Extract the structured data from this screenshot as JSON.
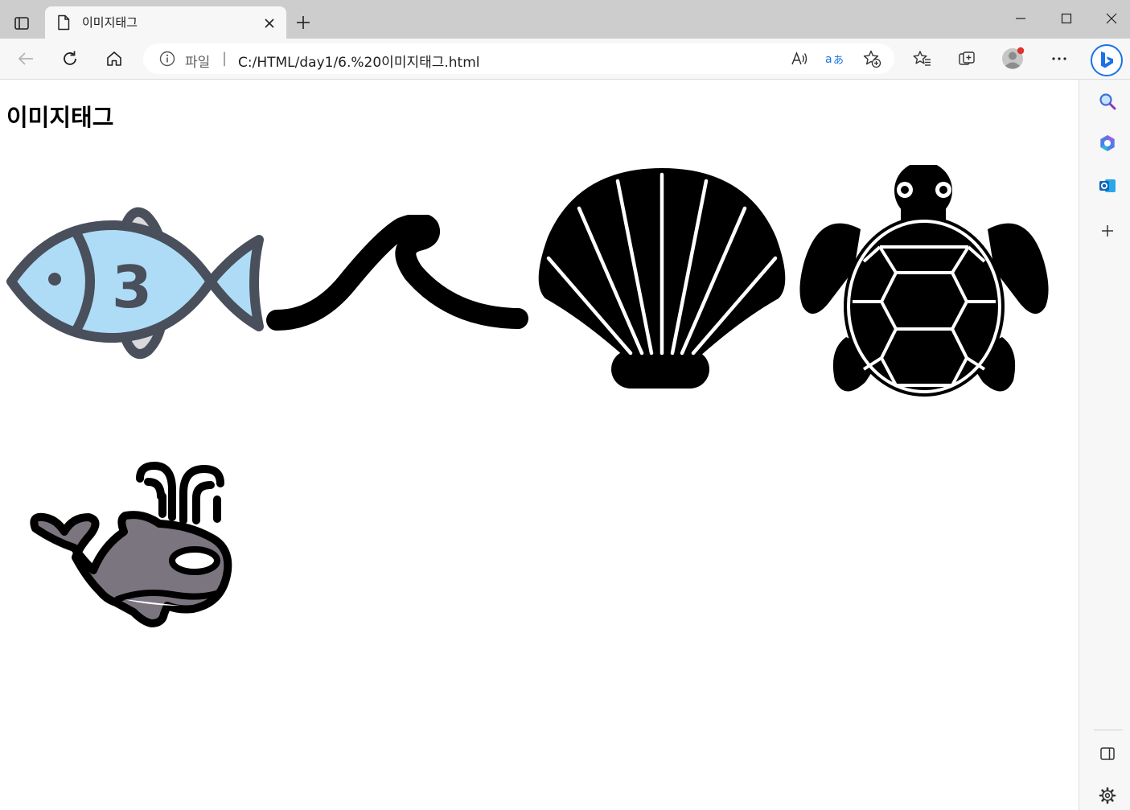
{
  "tab": {
    "title": "이미지태그"
  },
  "address_bar": {
    "scheme_label": "파일",
    "separator": "|",
    "url": "C:/HTML/day1/6.%20이미지태그.html"
  },
  "page": {
    "heading": "이미지태그",
    "images": [
      {
        "name": "fish",
        "digit": "3"
      },
      {
        "name": "wave"
      },
      {
        "name": "shell"
      },
      {
        "name": "turtle"
      },
      {
        "name": "whale"
      }
    ]
  },
  "icons": [
    "tab-actions-icon",
    "page-icon",
    "close-icon",
    "new-tab-icon",
    "minimize-icon",
    "maximize-icon",
    "window-close-icon",
    "back-icon",
    "refresh-icon",
    "home-icon",
    "info-icon",
    "read-aloud-icon",
    "translate-icon",
    "add-favorite-icon",
    "favorites-icon",
    "collections-icon",
    "profile-icon",
    "more-icon",
    "bing-icon",
    "search-icon",
    "copilot-icon",
    "outlook-icon",
    "add-icon",
    "sidebar-layout-icon",
    "settings-icon"
  ],
  "colors": {
    "fish_body": "#aedcf6",
    "fish_outline": "#4a4f5c",
    "fish_fin": "#d9d9dc",
    "whale_body": "#7b7580",
    "accent": "#1b72e8",
    "profile_badge": "#e0322a"
  }
}
